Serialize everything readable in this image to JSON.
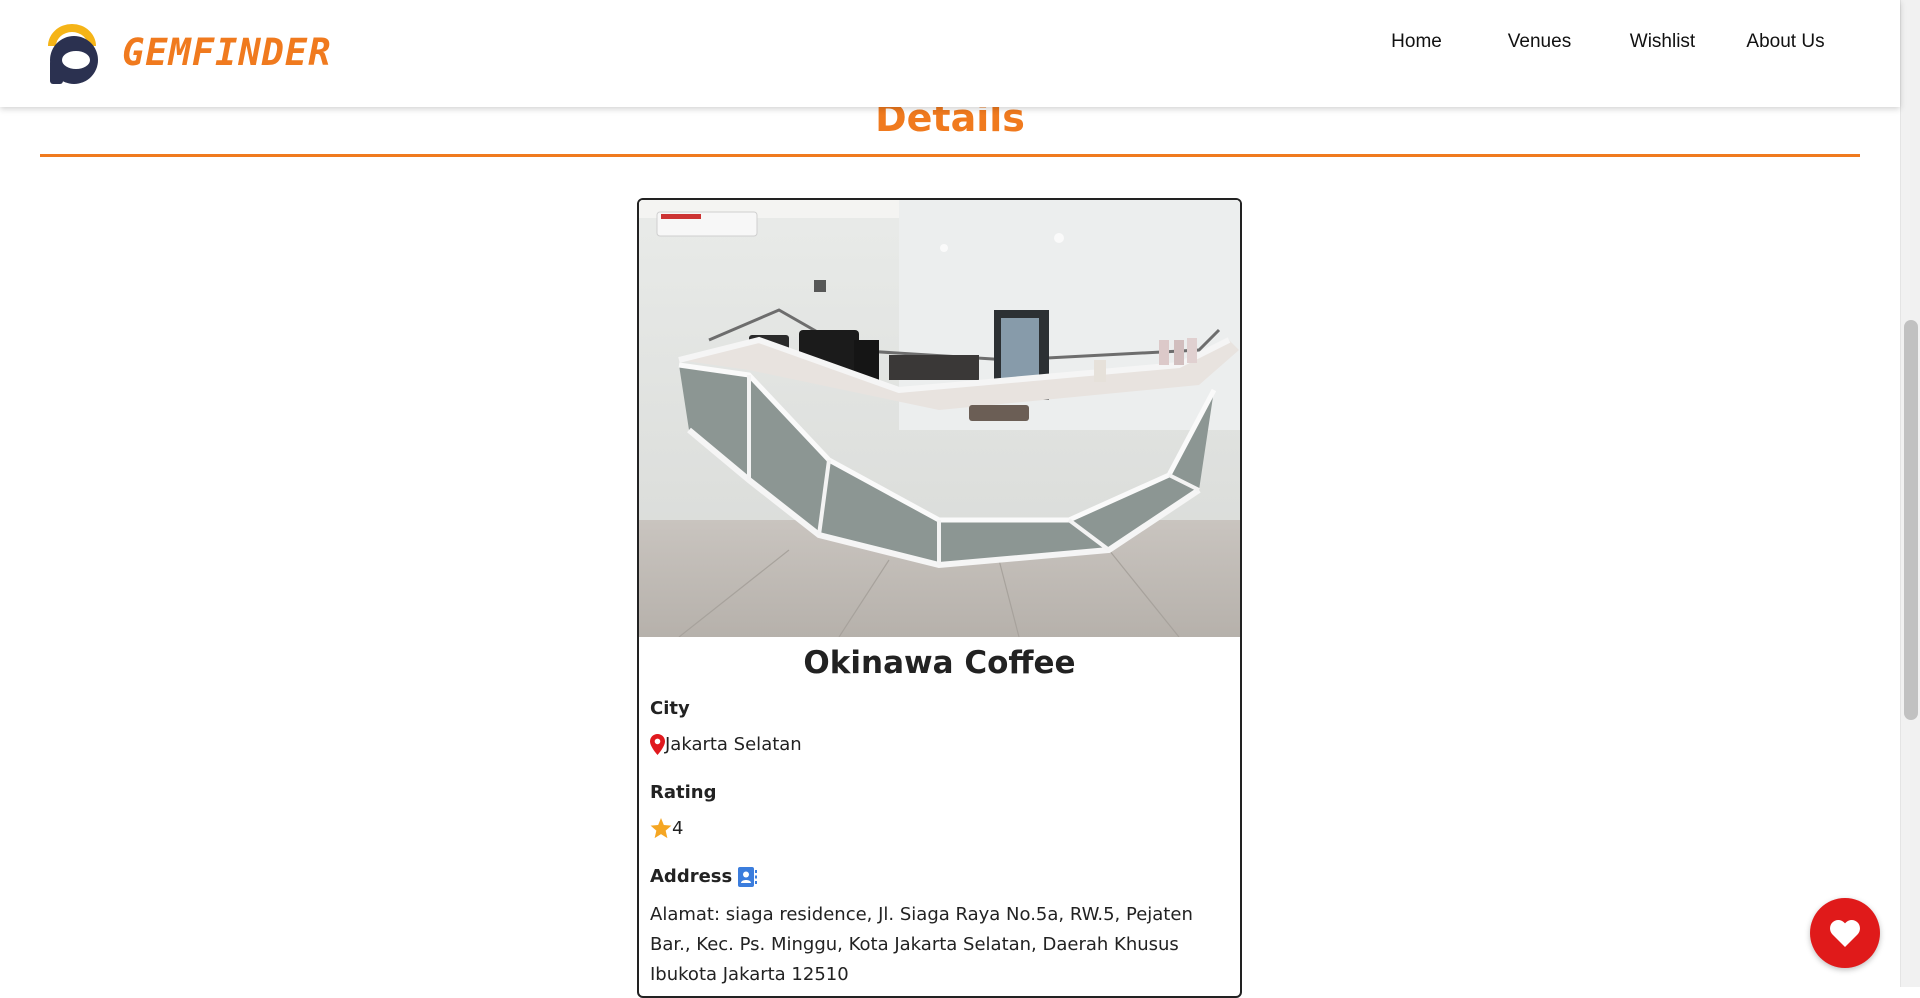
{
  "navbar": {
    "brand": "GEMFINDER",
    "links": [
      "Home",
      "Venues",
      "Wishlist",
      "About Us"
    ]
  },
  "section": {
    "title": "Details"
  },
  "venue": {
    "name": "Okinawa Coffee",
    "city_label": "City",
    "city": "Jakarta Selatan",
    "rating_label": "Rating",
    "rating": "4",
    "address_label": "Address",
    "address": "Alamat: siaga residence, Jl. Siaga Raya No.5a, RW.5, Pejaten Bar., Kec. Ps. Minggu, Kota Jakarta Selatan, Daerah Khusus Ibukota Jakarta 12510"
  },
  "icons": {
    "city": "map-pin-icon",
    "rating": "star-icon",
    "address": "contact-book-icon",
    "fab": "heart-icon"
  },
  "colors": {
    "brand_orange": "#f07a1e",
    "logo_navy": "#2b3150",
    "logo_yellow": "#f5b417",
    "pin_red": "#e0191e",
    "star_gold": "#f5a623",
    "address_blue": "#3b7ddd",
    "fab_red": "#e01a1a"
  }
}
